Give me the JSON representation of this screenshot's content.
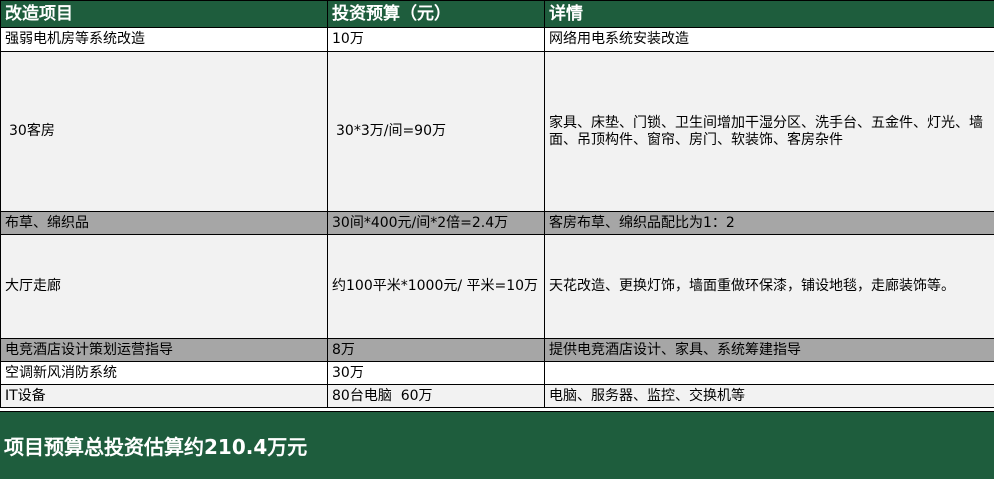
{
  "headers": {
    "col1": "改造项目",
    "col2": "投资预算（元）",
    "col3": "详情"
  },
  "rows": [
    {
      "project": "强弱电机房等系统改造",
      "budget": "10万",
      "detail": "网络用电系统安装改造"
    },
    {
      "project": "30客房",
      "budget": "30*3万/间=90万",
      "detail": "家具、床垫、门锁、卫生间增加干湿分区、洗手台、五金件、灯光、墙面、吊顶构件、窗帘、房门、软装饰、客房杂件"
    },
    {
      "project": "布草、绵织品",
      "budget": "30间*400元/间*2倍=2.4万",
      "detail": "客房布草、绵织品配比为1：2"
    },
    {
      "project": "大厅走廊",
      "budget": "约100平米*1000元/ 平米=10万",
      "detail": "天花改造、更换灯饰，墙面重做环保漆，铺设地毯，走廊装饰等。"
    },
    {
      "project": "电竞酒店设计策划运营指导",
      "budget": "8万",
      "detail": "提供电竞酒店设计、家具、系统筹建指导"
    },
    {
      "project": "空调新风消防系统",
      "budget": "30万",
      "detail": ""
    },
    {
      "project": "IT设备",
      "budget": "80台电脑  60万",
      "detail": "电脑、服务器、监控、交换机等"
    }
  ],
  "summary": "项目预算总投资估算约210.4万元",
  "colors": {
    "header_green": "#1e5d3d",
    "row_gray": "#f2f2f2",
    "row_dark_gray": "#a6a6a6"
  }
}
